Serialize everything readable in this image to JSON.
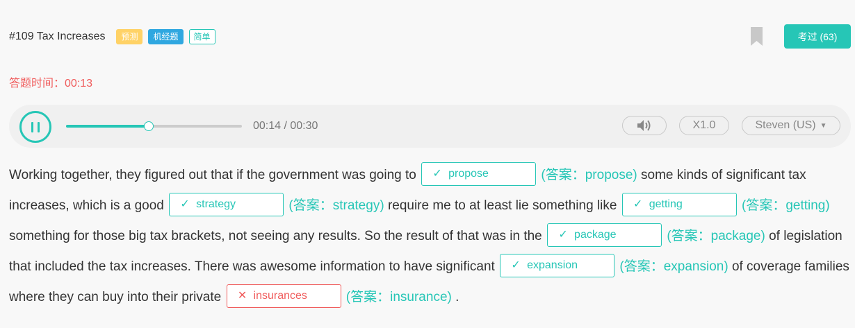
{
  "header": {
    "title": "#109 Tax Increases",
    "tags": [
      "预测",
      "机经题",
      "简单"
    ],
    "exam_button": "考过 (63)"
  },
  "timer": {
    "label": "答题时间：",
    "value": "00:13"
  },
  "player": {
    "time": "00:14 / 00:30",
    "progress": 0.47,
    "speed": "X1.0",
    "voice": "Steven (US)"
  },
  "passage": {
    "t1": "Working together, they figured out that if the government was going to",
    "b1": {
      "value": "propose",
      "answer": "(答案：propose)",
      "correct": true
    },
    "t2": "some kinds of significant tax increases, which is a good",
    "b2": {
      "value": "strategy",
      "answer": "(答案：strategy)",
      "correct": true
    },
    "t3": "require me to at least lie something like",
    "b3": {
      "value": "getting",
      "answer": "(答案：getting)",
      "correct": true
    },
    "t4": "something for those big tax brackets, not seeing any results. So the result of that was in the",
    "b4": {
      "value": "package",
      "answer": "(答案：package)",
      "correct": true
    },
    "t5": "of legislation that included the tax increases. There was awesome information to have significant",
    "b5": {
      "value": "expansion",
      "answer": "(答案：expansion)",
      "correct": true
    },
    "t6": "of coverage families where they can buy into their private",
    "b6": {
      "value": "insurances",
      "answer": "(答案：insurance)",
      "correct": false
    },
    "t7": "."
  },
  "colors": {
    "accent": "#26c6b6",
    "error": "#f05c5c",
    "tag_predict": "#ffd266",
    "tag_machine": "#2fa7e0"
  },
  "icons": {
    "bookmark": "bookmark-icon",
    "pause": "pause-icon",
    "volume": "volume-icon",
    "correct": "check-icon",
    "wrong": "cross-icon",
    "dropdown": "caret-down-icon"
  }
}
